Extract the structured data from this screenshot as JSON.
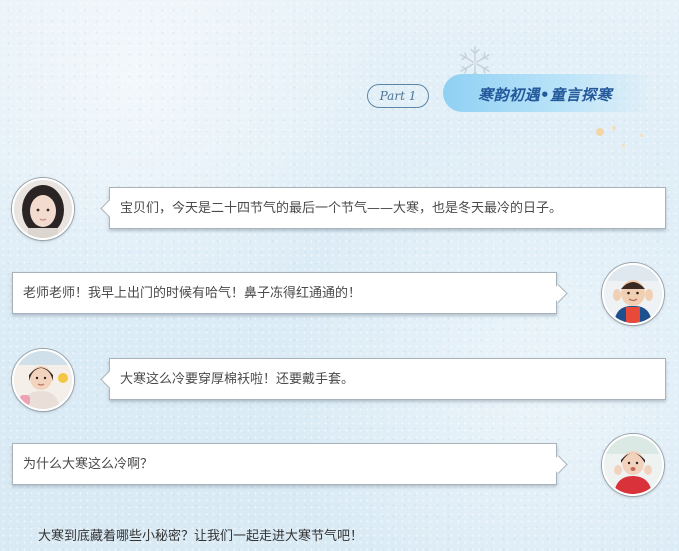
{
  "header": {
    "part_label": "Part 1",
    "title": "寒韵初遇•童言探寒"
  },
  "messages": [
    {
      "side": "left",
      "avatar": "teacher-avatar",
      "text": "宝贝们，今天是二十四节气的最后一个节气——大寒，也是冬天最冷的日子。"
    },
    {
      "side": "right",
      "avatar": "child-avatar-1",
      "text": "老师老师！我早上出门的时候有哈气！鼻子冻得红通通的！"
    },
    {
      "side": "left",
      "avatar": "child-avatar-2",
      "text": "大寒这么冷要穿厚棉袄啦！还要戴手套。"
    },
    {
      "side": "right",
      "avatar": "child-avatar-3",
      "text": "为什么大寒这么冷啊？"
    }
  ],
  "footer": {
    "text": "大寒到底藏着哪些小秘密？让我们一起走进大寒节气吧！"
  },
  "colors": {
    "accent": "#23599a",
    "banner": "#8fd0f4",
    "pill_border": "#5b86a8"
  }
}
